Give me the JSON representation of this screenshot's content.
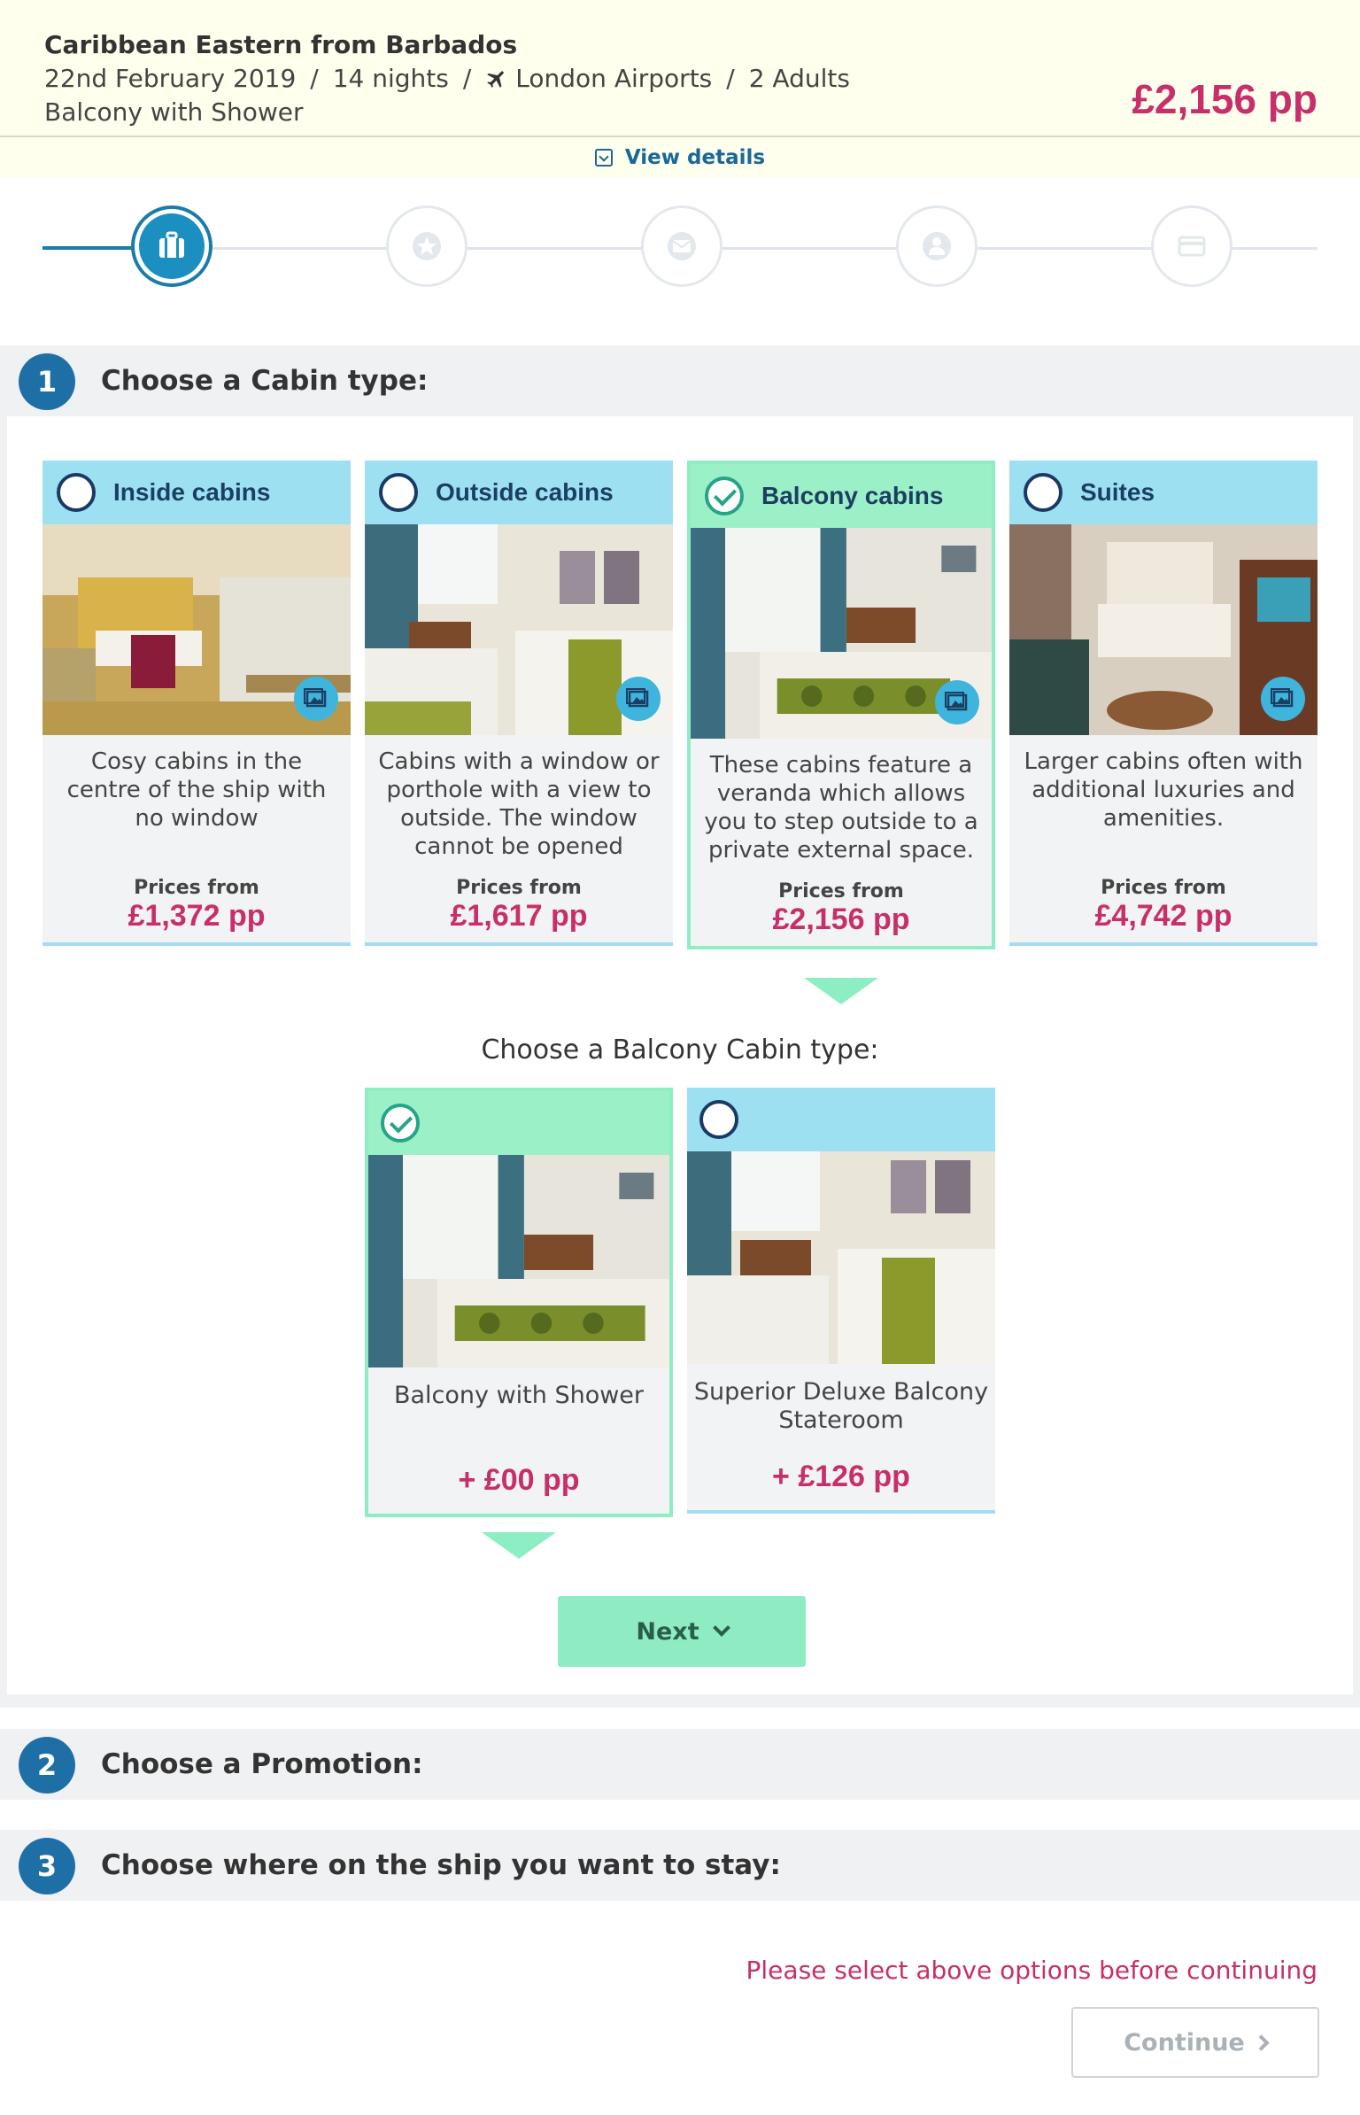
{
  "summary": {
    "title": "Caribbean Eastern from Barbados",
    "date": "22nd February 2019",
    "nights": "14 nights",
    "airport": "London Airports",
    "passengers": "2 Adults",
    "cabin": "Balcony with Shower",
    "total_price": "£2,156 pp",
    "separator": "/",
    "view_details": "View details"
  },
  "stepper": {
    "icons": [
      "suitcase-icon",
      "star-icon",
      "envelope-icon",
      "person-icon",
      "credit-card-icon"
    ],
    "active_index": 0
  },
  "sections": [
    {
      "number": "1",
      "label": "Choose a Cabin type:"
    },
    {
      "number": "2",
      "label": "Choose a Promotion:"
    },
    {
      "number": "3",
      "label": "Choose where on the ship you want to stay:"
    }
  ],
  "cabins": [
    {
      "name": "Inside cabins",
      "description": "Cosy cabins in the centre of the ship with no window",
      "prices_from": "Prices from",
      "price": "£1,372 pp",
      "selected": false
    },
    {
      "name": "Outside cabins",
      "description": "Cabins with a window or porthole with a view to outside. The window cannot be opened",
      "prices_from": "Prices from",
      "price": "£1,617 pp",
      "selected": false
    },
    {
      "name": "Balcony cabins",
      "description": "These cabins feature a veranda which allows you to step outside to a private external space.",
      "prices_from": "Prices from",
      "price": "£2,156 pp",
      "selected": true
    },
    {
      "name": "Suites",
      "description": "Larger cabins often with additional luxuries and amenities.",
      "prices_from": "Prices from",
      "price": "£4,742 pp",
      "selected": false
    }
  ],
  "subtype_title": "Choose a Balcony Cabin type:",
  "subtypes": [
    {
      "name": "Balcony with Shower",
      "price": "+ £00 pp",
      "selected": true
    },
    {
      "name": "Superior Deluxe Balcony Stateroom",
      "price": "+ £126 pp",
      "selected": false
    }
  ],
  "next_label": "Next",
  "warning": "Please select above options before continuing",
  "continue_label": "Continue",
  "colors": {
    "accent_pink": "#c82f6a",
    "primary_blue": "#1a7ca9",
    "selected_green": "#8eeec3",
    "card_head_blue": "#9de0f2"
  }
}
